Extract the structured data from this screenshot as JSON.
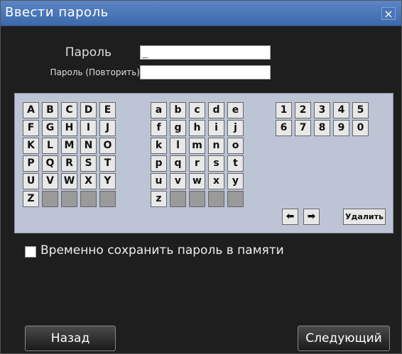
{
  "window": {
    "title": "Ввести пароль",
    "close_glyph": "×"
  },
  "form": {
    "password_label": "Пароль",
    "password_value": "_",
    "repeat_label": "Пароль (Повторить)",
    "repeat_value": ""
  },
  "keyboard": {
    "upper": [
      [
        "A",
        "B",
        "C",
        "D",
        "E"
      ],
      [
        "F",
        "G",
        "H",
        "I",
        "J"
      ],
      [
        "K",
        "L",
        "M",
        "N",
        "O"
      ],
      [
        "P",
        "Q",
        "R",
        "S",
        "T"
      ],
      [
        "U",
        "V",
        "W",
        "X",
        "Y"
      ],
      [
        "Z",
        "",
        "",
        "",
        ""
      ]
    ],
    "lower": [
      [
        "a",
        "b",
        "c",
        "d",
        "e"
      ],
      [
        "f",
        "g",
        "h",
        "i",
        "j"
      ],
      [
        "k",
        "l",
        "m",
        "n",
        "o"
      ],
      [
        "p",
        "q",
        "r",
        "s",
        "t"
      ],
      [
        "u",
        "v",
        "w",
        "x",
        "y"
      ],
      [
        "z",
        "",
        "",
        "",
        ""
      ]
    ],
    "digits": [
      [
        "1",
        "2",
        "3",
        "4",
        "5"
      ],
      [
        "6",
        "7",
        "8",
        "9",
        "0"
      ]
    ],
    "left_arrow": "⬅",
    "right_arrow": "➡",
    "delete_label": "Удалить"
  },
  "options": {
    "remember_label": "Временно сохранить пароль в памяти",
    "remember_checked": false
  },
  "footer": {
    "back_label": "Назад",
    "next_label": "Следующий"
  }
}
